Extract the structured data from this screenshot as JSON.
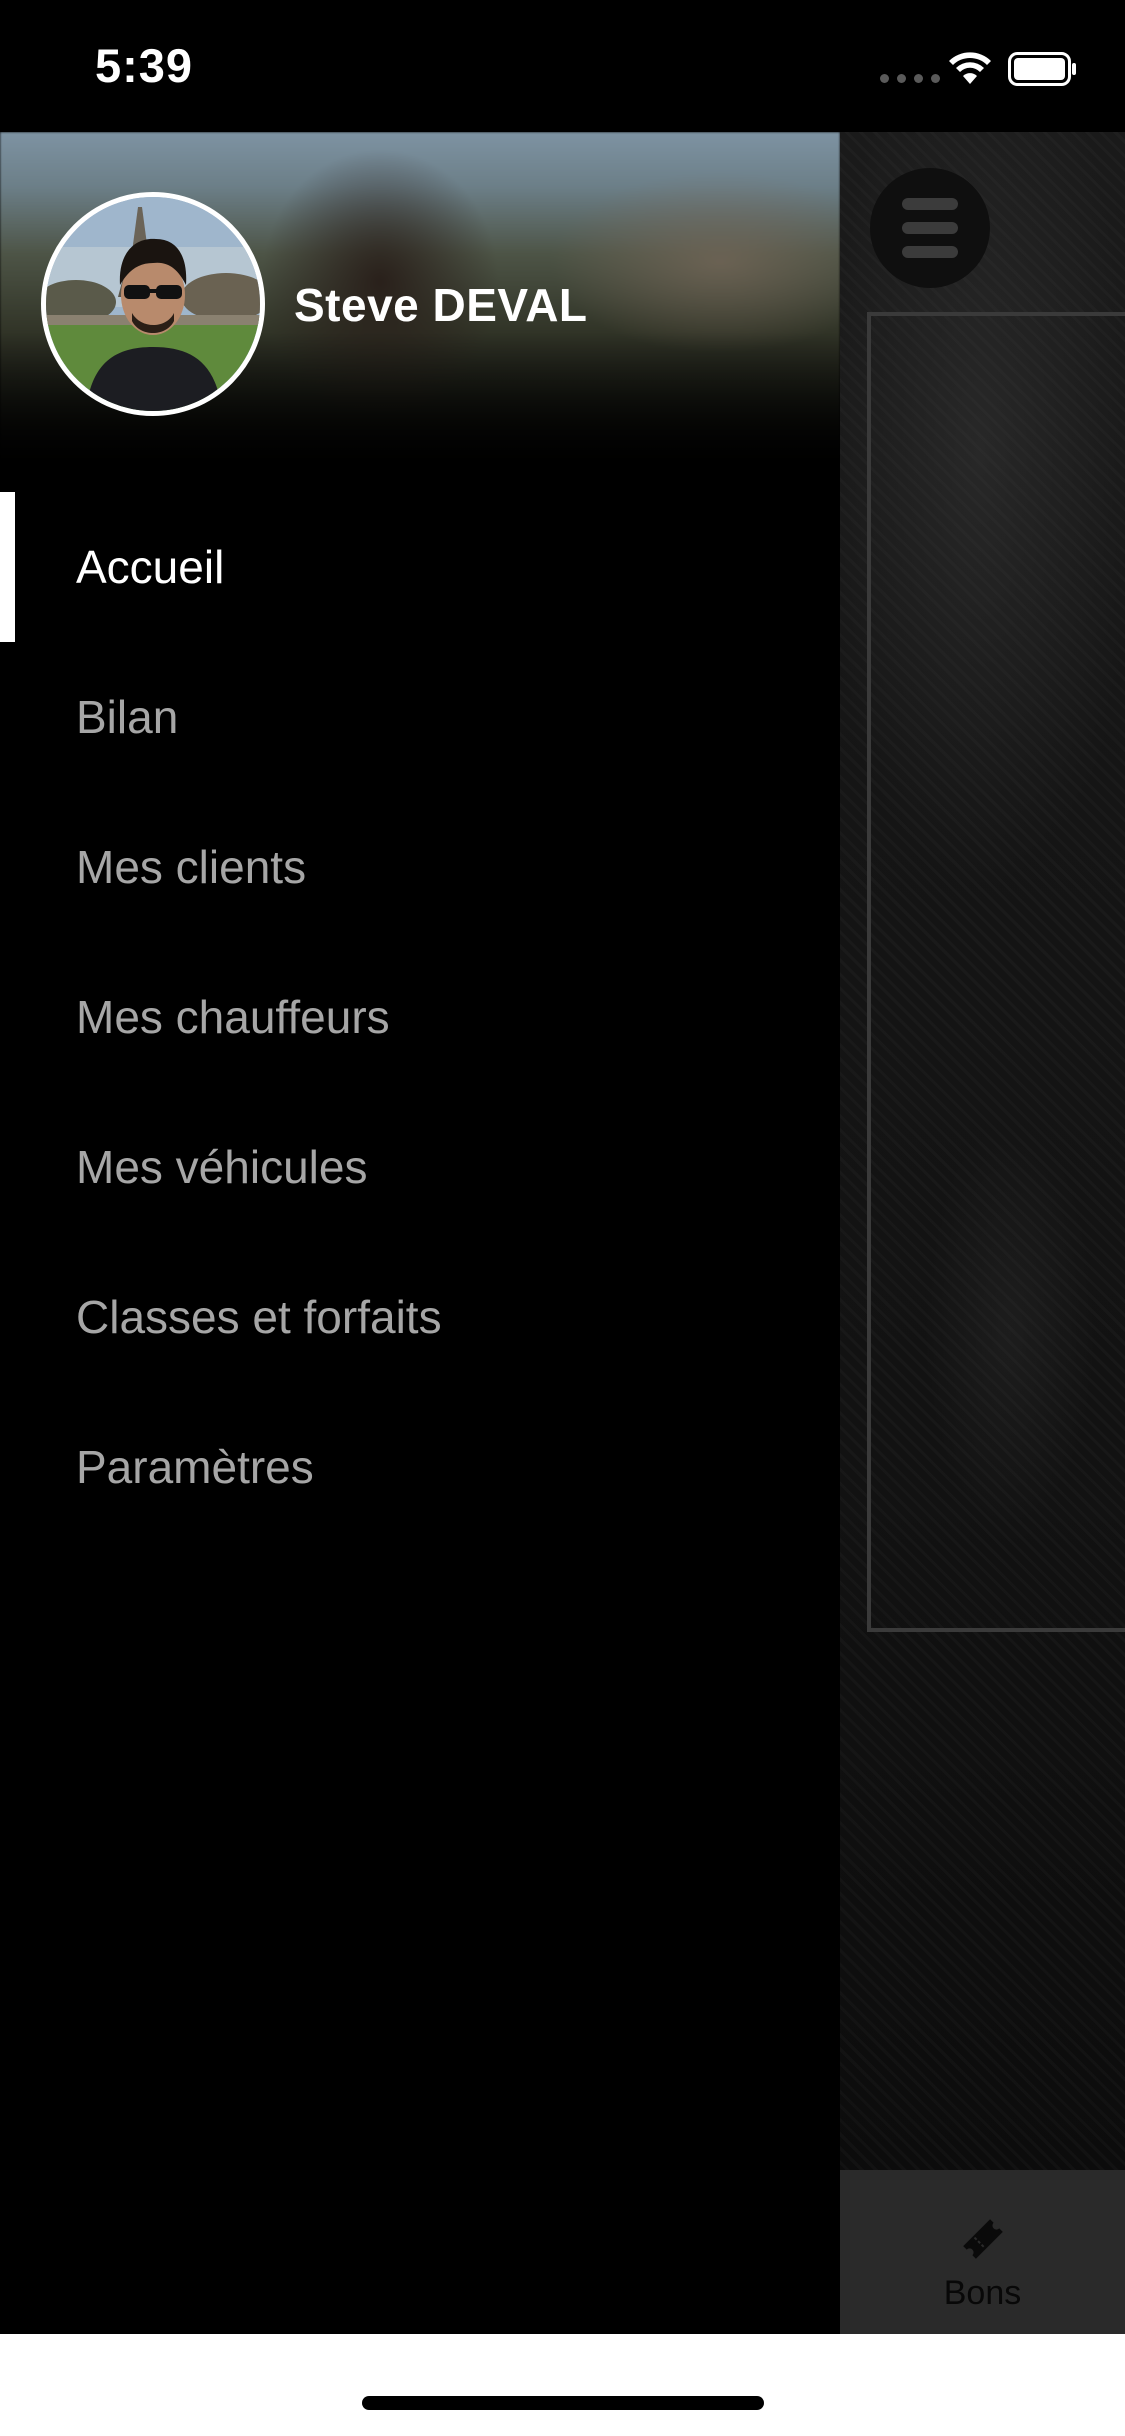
{
  "status_bar": {
    "time": "5:39",
    "icons": [
      "signal-dots-icon",
      "wifi-icon",
      "battery-icon"
    ]
  },
  "drawer": {
    "user": {
      "name": "Steve DEVAL",
      "avatar_icon": "profile-photo"
    },
    "nav_items": [
      {
        "label": "Accueil",
        "active": true
      },
      {
        "label": "Bilan",
        "active": false
      },
      {
        "label": "Mes clients",
        "active": false
      },
      {
        "label": "Mes chauffeurs",
        "active": false
      },
      {
        "label": "Mes véhicules",
        "active": false
      },
      {
        "label": "Classes et forfaits",
        "active": false
      },
      {
        "label": "Paramètres",
        "active": false
      }
    ]
  },
  "main_app": {
    "menu_icon": "hamburger-menu-icon",
    "bottom_tab": {
      "label": "Bons",
      "icon": "ticket-icon"
    }
  },
  "colors": {
    "background": "#000000",
    "active_text": "#ffffff",
    "inactive_text": "#a6a6a6",
    "active_indicator": "#ffffff"
  }
}
